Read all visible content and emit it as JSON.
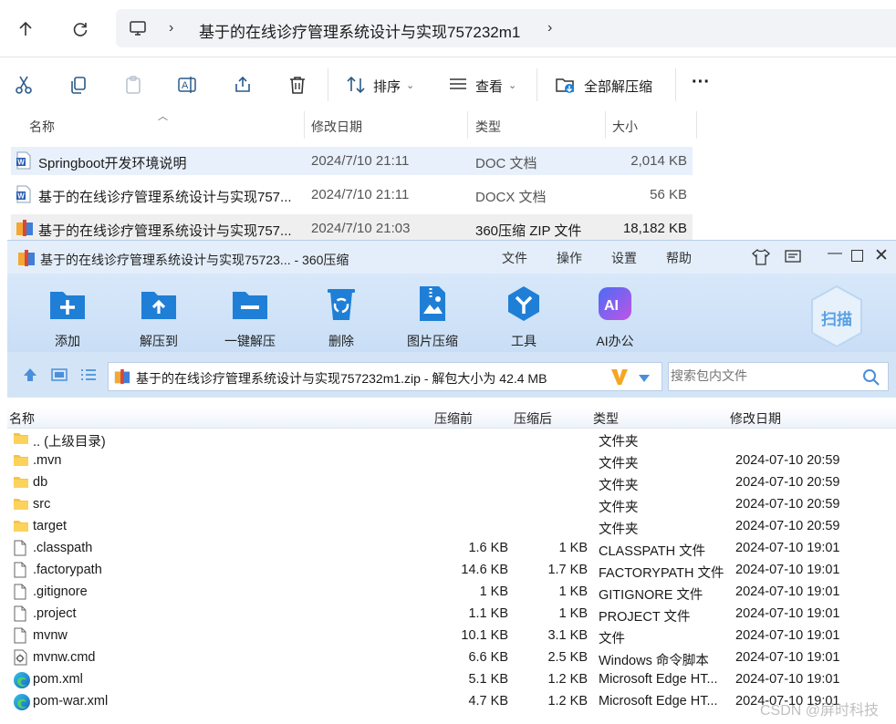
{
  "explorer": {
    "folder_path": "基于的在线诊疗管理系统设计与实现757232m1",
    "toolbar": {
      "sort_label": "排序",
      "view_label": "查看",
      "extract_all_label": "全部解压缩",
      "more_label": "···"
    },
    "columns": [
      "名称",
      "修改日期",
      "类型",
      "大小"
    ],
    "files": [
      {
        "name": "Springboot开发环境说明",
        "date": "2024/7/10 21:11",
        "type": "DOC 文档",
        "size": "2,014 KB",
        "icon": "word-icon"
      },
      {
        "name": "基于的在线诊疗管理系统设计与实现757...",
        "date": "2024/7/10 21:11",
        "type": "DOCX 文档",
        "size": "56 KB",
        "icon": "word-icon"
      },
      {
        "name": "基于的在线诊疗管理系统设计与实现757...",
        "date": "2024/7/10 21:03",
        "type": "360压缩 ZIP 文件",
        "size": "18,182 KB",
        "icon": "zip-icon"
      }
    ]
  },
  "zip": {
    "title": "基于的在线诊疗管理系统设计与实现75723... - 360压缩",
    "menu": [
      "文件",
      "操作",
      "设置",
      "帮助"
    ],
    "tools": [
      "添加",
      "解压到",
      "一键解压",
      "删除",
      "图片压缩",
      "工具",
      "AI办公"
    ],
    "scan_label": "扫描",
    "path": "基于的在线诊疗管理系统设计与实现757232m1.zip - 解包大小为 42.4 MB",
    "search_placeholder": "搜索包内文件",
    "columns": [
      "名称",
      "压缩前",
      "压缩后",
      "类型",
      "修改日期"
    ],
    "rows": [
      {
        "name": ".. (上级目录)",
        "before": "",
        "after": "",
        "type": "文件夹",
        "date": "",
        "icon": "folder-icon"
      },
      {
        "name": ".mvn",
        "before": "",
        "after": "",
        "type": "文件夹",
        "date": "2024-07-10 20:59",
        "icon": "folder-icon"
      },
      {
        "name": "db",
        "before": "",
        "after": "",
        "type": "文件夹",
        "date": "2024-07-10 20:59",
        "icon": "folder-icon"
      },
      {
        "name": "src",
        "before": "",
        "after": "",
        "type": "文件夹",
        "date": "2024-07-10 20:59",
        "icon": "folder-icon"
      },
      {
        "name": "target",
        "before": "",
        "after": "",
        "type": "文件夹",
        "date": "2024-07-10 20:59",
        "icon": "folder-icon"
      },
      {
        "name": ".classpath",
        "before": "1.6 KB",
        "after": "1 KB",
        "type": "CLASSPATH 文件",
        "date": "2024-07-10 19:01",
        "icon": "file-icon"
      },
      {
        "name": ".factorypath",
        "before": "14.6 KB",
        "after": "1.7 KB",
        "type": "FACTORYPATH 文件",
        "date": "2024-07-10 19:01",
        "icon": "file-icon"
      },
      {
        "name": ".gitignore",
        "before": "1 KB",
        "after": "1 KB",
        "type": "GITIGNORE 文件",
        "date": "2024-07-10 19:01",
        "icon": "file-icon"
      },
      {
        "name": ".project",
        "before": "1.1 KB",
        "after": "1 KB",
        "type": "PROJECT 文件",
        "date": "2024-07-10 19:01",
        "icon": "file-icon"
      },
      {
        "name": "mvnw",
        "before": "10.1 KB",
        "after": "3.1 KB",
        "type": "文件",
        "date": "2024-07-10 19:01",
        "icon": "file-icon"
      },
      {
        "name": "mvnw.cmd",
        "before": "6.6 KB",
        "after": "2.5 KB",
        "type": "Windows 命令脚本",
        "date": "2024-07-10 19:01",
        "icon": "cmd-icon"
      },
      {
        "name": "pom.xml",
        "before": "5.1 KB",
        "after": "1.2 KB",
        "type": "Microsoft Edge HT...",
        "date": "2024-07-10 19:01",
        "icon": "edge-icon"
      },
      {
        "name": "pom-war.xml",
        "before": "4.7 KB",
        "after": "1.2 KB",
        "type": "Microsoft Edge HT...",
        "date": "2024-07-10 19:01",
        "icon": "edge-icon"
      }
    ]
  },
  "watermark": "CSDN @屏时科技",
  "colors": {
    "accent": "#1f7fd6",
    "ribbon": "#d2e4f8",
    "selected_row": "#e8f0fb"
  }
}
